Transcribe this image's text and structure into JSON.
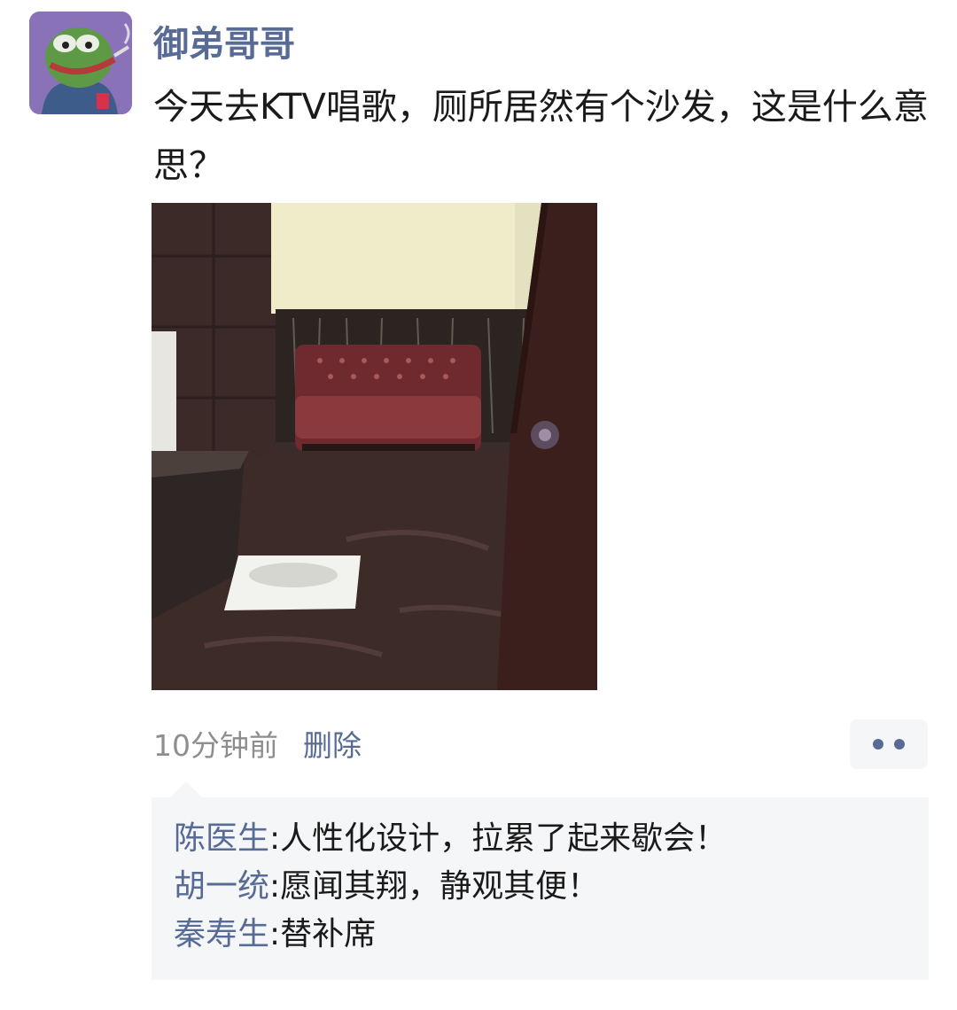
{
  "post": {
    "author": "御弟哥哥",
    "text": "今天去KTV唱歌，厕所居然有个沙发，这是什么意思？",
    "avatar_icon": "pepe-frog-smoking-avatar",
    "image_description": "ktv-bathroom-sofa-photo",
    "timestamp": "10分钟前",
    "delete_label": "删除"
  },
  "comments": [
    {
      "name": "陈医生",
      "separator": ":",
      "text": "人性化设计，拉累了起来歇会！"
    },
    {
      "name": "胡一统",
      "separator": ":",
      "text": "愿闻其翔，静观其便！"
    },
    {
      "name": "秦寿生",
      "separator": ":",
      "text": "替补席"
    }
  ],
  "colors": {
    "link": "#576b95",
    "text": "#1a1a1a",
    "meta": "#8e8e8e",
    "comment_bg": "#f5f6f8"
  }
}
